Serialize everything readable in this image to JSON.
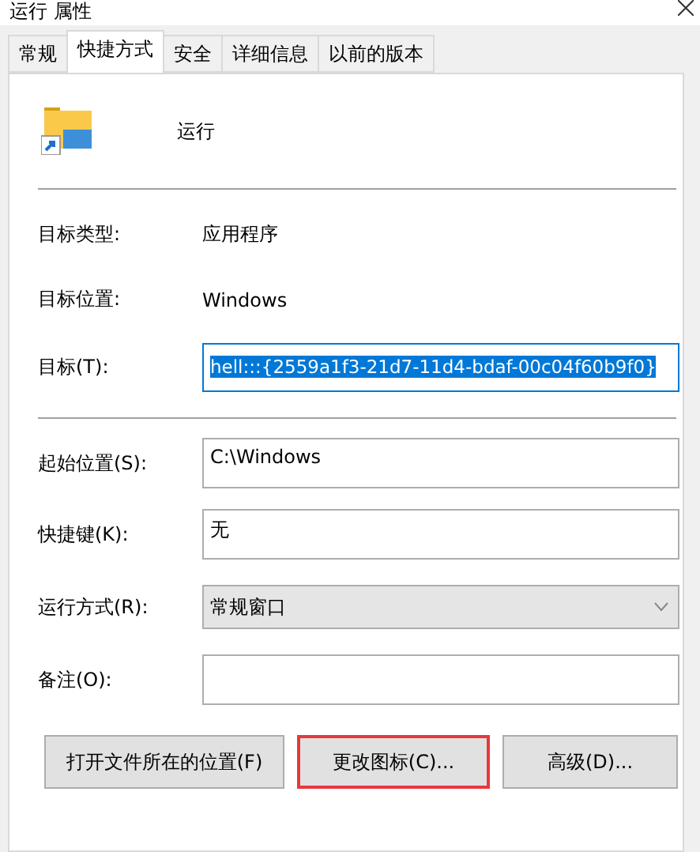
{
  "window": {
    "title": "运行 属性"
  },
  "tabs": [
    {
      "label": "常规",
      "selected": false
    },
    {
      "label": "快捷方式",
      "selected": true
    },
    {
      "label": "安全",
      "selected": false
    },
    {
      "label": "详细信息",
      "selected": false
    },
    {
      "label": "以前的版本",
      "selected": false
    }
  ],
  "header": {
    "name": "运行"
  },
  "info": [
    {
      "label": "目标类型:",
      "value": "应用程序"
    },
    {
      "label": "目标位置:",
      "value": "Windows"
    }
  ],
  "target": {
    "label": "目标(T):",
    "value": "hell:::{2559a1f3-21d7-11d4-bdaf-00c04f60b9f0}",
    "selected": true
  },
  "fields": [
    {
      "kind": "text",
      "label": "起始位置(S):",
      "value": "C:\\Windows"
    },
    {
      "kind": "text",
      "label": "快捷键(K):",
      "value": "无"
    },
    {
      "kind": "select",
      "label": "运行方式(R):",
      "value": "常规窗口"
    },
    {
      "kind": "text",
      "label": "备注(O):"
    }
  ],
  "buttons": [
    {
      "label": "打开文件所在的位置(F)",
      "highlighted": false
    },
    {
      "label": "更改图标(C)...",
      "highlighted": true
    },
    {
      "label": "高级(D)...",
      "highlighted": false
    }
  ]
}
